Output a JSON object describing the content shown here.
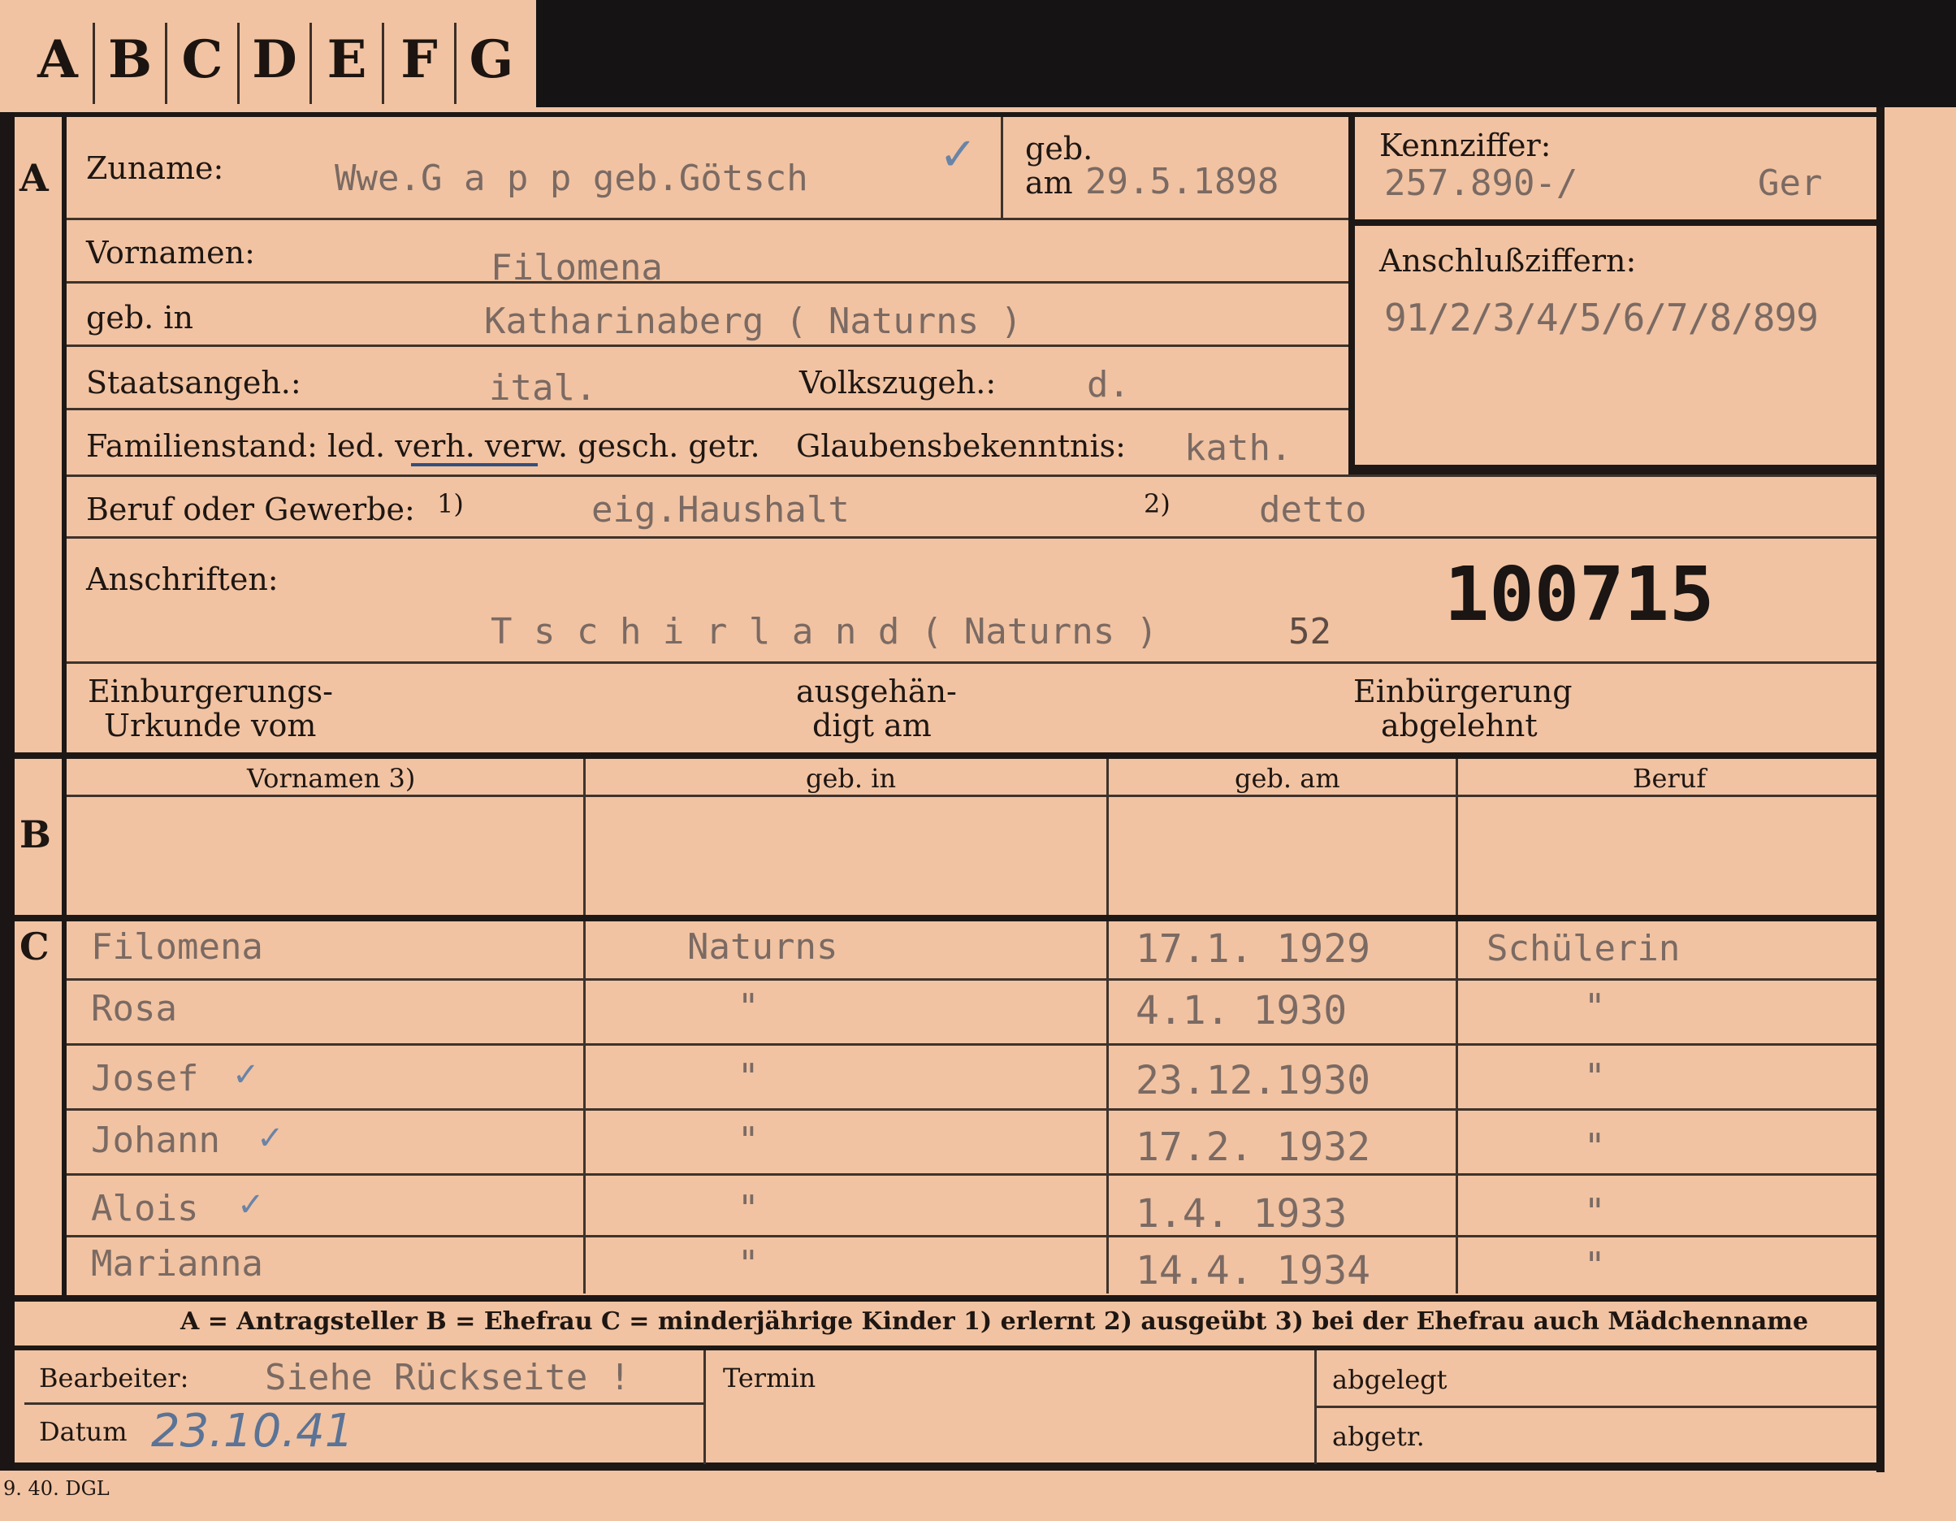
{
  "tabs": [
    "A",
    "B",
    "C",
    "D",
    "E",
    "F",
    "G"
  ],
  "sections": {
    "a": "A",
    "b": "B",
    "c": "C"
  },
  "labels": {
    "zuname": "Zuname:",
    "geb": "geb.",
    "am": "am",
    "kennziffer": "Kennziffer:",
    "vornamen": "Vornamen:",
    "anschlussziffern": "Anschlußziffern:",
    "geb_in": "geb. in",
    "staatsangeh": "Staatsangeh.:",
    "volkszugeh": "Volkszugeh.:",
    "familienstand": "Familienstand: led. verh. verw. gesch. getr.",
    "glaubens": "Glaubensbekenntnis:",
    "beruf": "Beruf oder Gewerbe:",
    "beruf_note1": "1)",
    "beruf_note2": "2)",
    "anschriften": "Anschriften:",
    "einb_urkunde_1": "Einburgerungs-",
    "einb_urkunde_2": "Urkunde vom",
    "ausgehaendigt_1": "ausgehän-",
    "ausgehaendigt_2": "digt am",
    "einb_abgelehnt_1": "Einbürgerung",
    "einb_abgelehnt_2": "abgelehnt",
    "legend": "A = Antragsteller   B = Ehefrau   C = minderjährige Kinder   1) erlernt   2) ausgeübt   3) bei der Ehefrau auch Mädchenname",
    "bearbeiter": "Bearbeiter:",
    "datum": "Datum",
    "termin": "Termin",
    "abgelegt": "abgelegt",
    "abgetr": "abgetr.",
    "print_code": "9. 40. DGL"
  },
  "fields": {
    "zuname": "Wwe.G a  p p  geb.Götsch",
    "geb_am": "29.5.1898",
    "kennziffer": "257.890-/",
    "kennziffer_suffix": "Ger",
    "vornamen": "Filomena",
    "anschlussziffern": "91/2/3/4/5/6/7/8/899",
    "geb_in": "Katharinaberg ( Naturns )",
    "staatsangeh": "ital.",
    "volkszugeh": "d.",
    "glaubens": "kath.",
    "beruf_1": "eig.Haushalt",
    "beruf_2": "detto",
    "anschrift": "T s c h i r l a n d ( Naturns )",
    "anschrift_nr": "52",
    "stamp_number": "100715",
    "bearbeiter": "Siehe Rückseite !",
    "datum": "23.10.41"
  },
  "table_b": {
    "headers": [
      "Vornamen 3)",
      "geb. in",
      "geb. am",
      "Beruf"
    ]
  },
  "table_c": {
    "rows": [
      {
        "vorname": "Filomena",
        "geb_in": "Naturns",
        "geb_am": "17.1. 1929",
        "beruf": "Schülerin"
      },
      {
        "vorname": "Rosa",
        "geb_in": "\"",
        "geb_am": "4.1. 1930",
        "beruf": "\""
      },
      {
        "vorname": "Josef",
        "geb_in": "\"",
        "geb_am": "23.12.1930",
        "beruf": "\""
      },
      {
        "vorname": "Johann",
        "geb_in": "\"",
        "geb_am": "17.2. 1932",
        "beruf": "\""
      },
      {
        "vorname": "Alois",
        "geb_in": "\"",
        "geb_am": "1.4. 1933",
        "beruf": "\""
      },
      {
        "vorname": "Marianna",
        "geb_in": "\"",
        "geb_am": "14.4. 1934",
        "beruf": "\""
      }
    ]
  },
  "colors": {
    "card": "#f1c3a2",
    "ink": "#1e1612",
    "typewriter": "#7b6a63",
    "pen": "#5a7396"
  }
}
